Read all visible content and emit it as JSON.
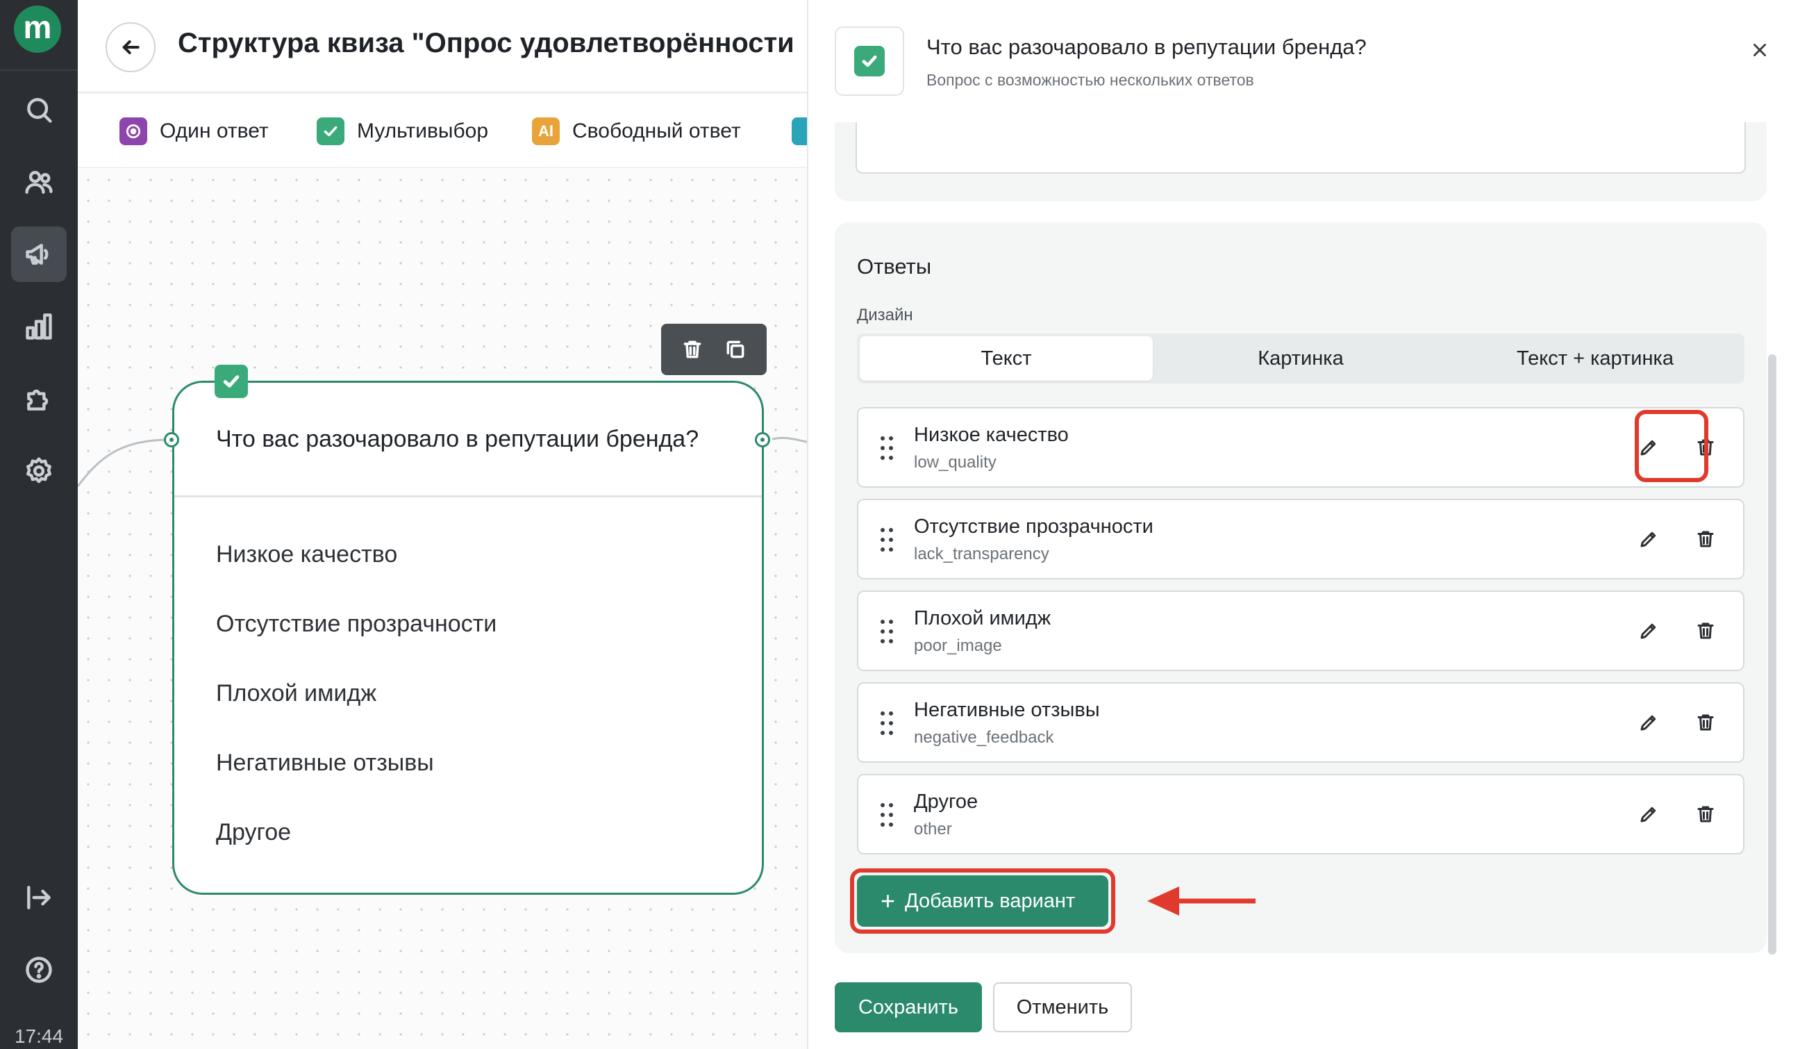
{
  "clock": "17:44",
  "app": {
    "logo_letter": "m"
  },
  "header": {
    "title": "Структура квиза \"Опрос удовлетворённости"
  },
  "toolbar": {
    "items": [
      {
        "label": "Один ответ",
        "color": "#8e44ad"
      },
      {
        "label": "Мультивыбор",
        "color": "#3aaa7a"
      },
      {
        "label": "Свободный ответ",
        "color": "#e8a43a",
        "icon_text": "AI"
      },
      {
        "label": "",
        "color": "#2ba3b8"
      }
    ]
  },
  "node": {
    "question": "Что вас разочаровало в репутации бренда?",
    "answers": [
      "Низкое качество",
      "Отсутствие прозрачности",
      "Плохой имидж",
      "Негативные отзывы",
      "Другое"
    ]
  },
  "panel": {
    "title": "Что вас разочаровало в репутации бренда?",
    "subtitle": "Вопрос с возможностью нескольких ответов",
    "answers_section": "Ответы",
    "design_label": "Дизайн",
    "design_options": [
      "Текст",
      "Картинка",
      "Текст + картинка"
    ],
    "selected_design": "Текст",
    "answers": [
      {
        "label": "Низкое качество",
        "value": "low_quality"
      },
      {
        "label": "Отсутствие прозрачности",
        "value": "lack_transparency"
      },
      {
        "label": "Плохой имидж",
        "value": "poor_image"
      },
      {
        "label": "Негативные отзывы",
        "value": "negative_feedback"
      },
      {
        "label": "Другое",
        "value": "other"
      }
    ],
    "add_button": "Добавить вариант",
    "save_button": "Сохранить",
    "cancel_button": "Отменить"
  },
  "colors": {
    "accent": "#2b8a6c",
    "highlight": "#e03a2c",
    "rail": "#2b2f33"
  }
}
